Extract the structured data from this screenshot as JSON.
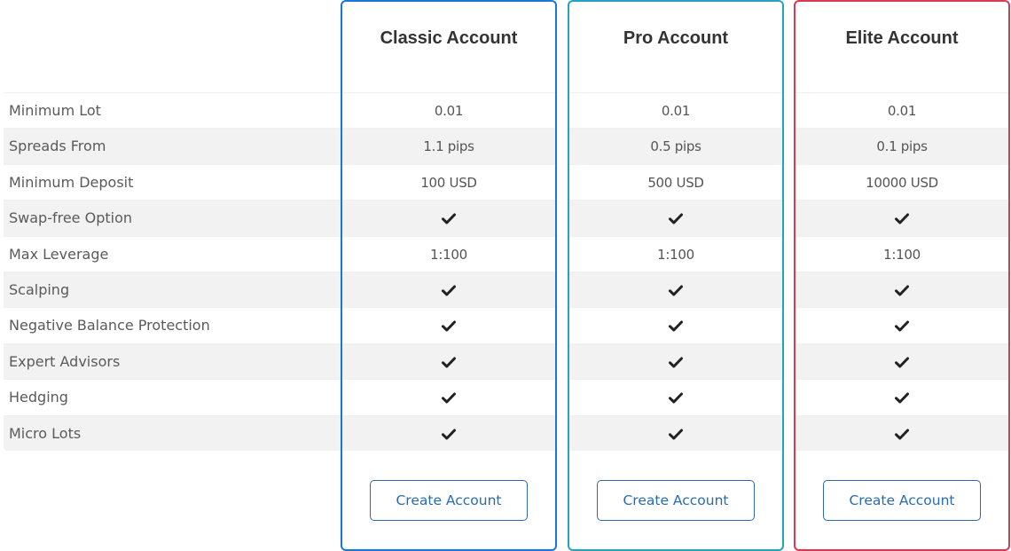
{
  "features": [
    "Minimum Lot",
    "Spreads From",
    "Minimum Deposit",
    "Swap-free Option",
    "Max Leverage",
    "Scalping",
    "Negative Balance Protection",
    "Expert Advisors",
    "Hedging",
    "Micro Lots"
  ],
  "accounts": [
    {
      "key": "classic",
      "title": "Classic Account",
      "border_color": "#1b76d9",
      "values": [
        "0.01",
        "1.1 pips",
        "100 USD",
        "check",
        "1:100",
        "check",
        "check",
        "check",
        "check",
        "check"
      ],
      "button_label": "Create Account"
    },
    {
      "key": "pro",
      "title": "Pro Account",
      "border_color": "#23a3bf",
      "values": [
        "0.01",
        "0.5 pips",
        "500 USD",
        "check",
        "1:100",
        "check",
        "check",
        "check",
        "check",
        "check"
      ],
      "button_label": "Create Account"
    },
    {
      "key": "elite",
      "title": "Elite Account",
      "border_color": "#d93a52",
      "values": [
        "0.01",
        "0.1 pips",
        "10000 USD",
        "check",
        "1:100",
        "check",
        "check",
        "check",
        "check",
        "check"
      ],
      "button_label": "Create Account"
    }
  ],
  "icons": {
    "check": "checkmark-icon"
  },
  "colors": {
    "button_text": "#2a6bb0",
    "row_alt_bg": "#f2f2f2"
  }
}
